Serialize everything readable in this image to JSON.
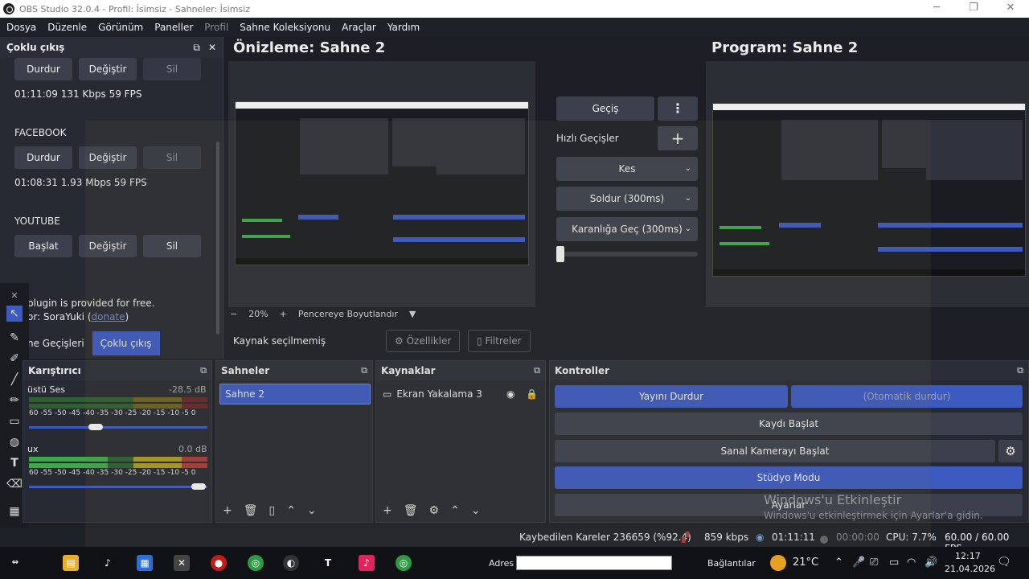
{
  "window": {
    "title": "OBS Studio 32.0.4 - Profil: İsimsiz - Sahneler: İsimsiz",
    "minimize": "─",
    "maximize": "❐",
    "close": "✕"
  },
  "menu": [
    "Dosya",
    "Düzenle",
    "Görünüm",
    "Paneller",
    "Profil",
    "Sahne Koleksiyonu",
    "Araçlar",
    "Yardım"
  ],
  "multi_output": {
    "title": "Çoklu çıkış",
    "first": {
      "stop": "Durdur",
      "edit": "Değiştir",
      "delete": "Sil",
      "stats": "01:11:09  131 Kbps  59 FPS"
    },
    "facebook": {
      "name": "FACEBOOK",
      "stop": "Durdur",
      "edit": "Değiştir",
      "delete": "Sil",
      "stats": "01:08:31  1.93 Mbps  59 FPS"
    },
    "youtube": {
      "name": "YOUTUBE",
      "start": "Başlat",
      "edit": "Değiştir",
      "delete": "Sil"
    },
    "plugin_text": "plugin is provided for free.",
    "author_prefix": "or: SoraYuki (",
    "donate": "donate",
    "author_suffix": ")"
  },
  "dock_tabs": {
    "scene_transitions": "ne Geçişleri",
    "multi_output": "Çoklu çıkış"
  },
  "preview": {
    "title": "Önizleme: Sahne 2",
    "zoom": "20%",
    "zoom_minus": "−",
    "zoom_plus": "+",
    "fit": "Pencereye Boyutlandır"
  },
  "program": {
    "title": "Program: Sahne 2"
  },
  "transitions": {
    "transition_button": "Geçiş",
    "quick_label": "Hızlı Geçişler",
    "items": [
      "Kes",
      "Soldur (300ms)",
      "Karanlığa Geç (300ms)"
    ]
  },
  "context": {
    "no_source": "Kaynak seçilmemiş",
    "properties": "Özellikler",
    "filters": "Filtreler"
  },
  "mixer": {
    "title": "Karıştırıcı",
    "tracks": [
      {
        "name": "üstü Ses",
        "db": "-28.5 dB",
        "level": 0.45
      },
      {
        "name": "ux",
        "db": "0.0 dB",
        "level": 1.0
      }
    ],
    "scale": "60 -55 -50 -45 -40 -35 -30 -25 -20 -15 -10  -5   0"
  },
  "scenes": {
    "title": "Sahneler",
    "items": [
      "Sahne 2"
    ]
  },
  "sources": {
    "title": "Kaynaklar",
    "items": [
      "Ekran Yakalama 3"
    ]
  },
  "controls": {
    "title": "Kontroller",
    "stop_stream": "Yayını Durdur",
    "auto_stop": "(Otomatik durdur)",
    "start_recording": "Kaydı Başlat",
    "start_virtualcam": "Sanal Kamerayı Başlat",
    "studio_mode": "Stüdyo Modu",
    "settings": "Ayarlar"
  },
  "activation": {
    "title": "Windows'u Etkinleştir",
    "subtitle": "Windows'u etkinleştirmek için Ayarlar'a gidin."
  },
  "status": {
    "dropped": "Kaybedilen Kareler 236659 (%92.4)",
    "kbps": "859 kbps",
    "stream_time": "01:11:11",
    "rec_time": "00:00:00",
    "cpu": "CPU: 7.7%",
    "fps": "60.00 / 60.00 FPS"
  },
  "taskbar": {
    "address_label": "Adres",
    "connections": "Bağlantılar",
    "temperature": "21°C",
    "time": "12:17",
    "date": "21.04.2026"
  },
  "colors": {
    "accent": "#3d5ac1",
    "meter_green": "#3ea84b",
    "meter_yellow": "#a89a2a",
    "meter_red": "#a83a3a"
  }
}
